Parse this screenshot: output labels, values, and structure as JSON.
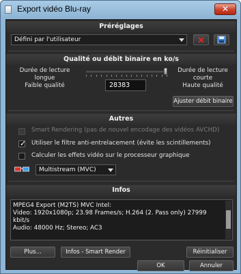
{
  "window": {
    "title": "Export vidéo Blu-ray",
    "close_glyph": "✕"
  },
  "presets": {
    "header": "Préréglages",
    "selected": "Défini par l'utilisateur",
    "delete_icon": "delete-icon",
    "save_icon": "save-icon"
  },
  "quality": {
    "header": "Qualité ou débit binaire en ko/s",
    "left_label_1": "Durée de lecture",
    "left_label_2": "longue",
    "left_label_3": "Faible qualité",
    "right_label_1": "Durée de lecture",
    "right_label_2": "courte",
    "right_label_3": "Haute qualité",
    "value": "28383",
    "slider_level": 1.0,
    "adjust_button": "Ajuster débit binaire"
  },
  "other": {
    "header": "Autres",
    "smart_rendering": "Smart Rendering (pas de nouvel encodage des vidéos AVCHD)",
    "smart_rendering_checked": false,
    "deinterlace": "Utiliser le filtre anti-entrelacement (évite les scintillements)",
    "deinterlace_checked": true,
    "gpu_effects": "Calculer les effets vidéo sur le processeur graphique",
    "gpu_effects_checked": false,
    "stereo_mode": "Multistream (MVC)",
    "stereo_icon": "3d-glasses-icon"
  },
  "info": {
    "header": "Infos",
    "lines": [
      "MPEG4 Export (M2TS) MVC Intel:",
      "Video: 1920x1080p; 23.98 Frames/s; H.264 (2. Pass only) 27999",
      "kbit/s",
      "Audio: 48000 Hz; Stereo;  AC3"
    ]
  },
  "buttons": {
    "more": "Plus...",
    "smart_render_info": "Infos - Smart Render",
    "reset": "Réinitialiser",
    "ok": "OK",
    "cancel": "Annuler"
  },
  "colors": {
    "window_frame": "#8fb6d6",
    "client_bg": "#2b2b2b",
    "close_red": "#c8432b"
  }
}
